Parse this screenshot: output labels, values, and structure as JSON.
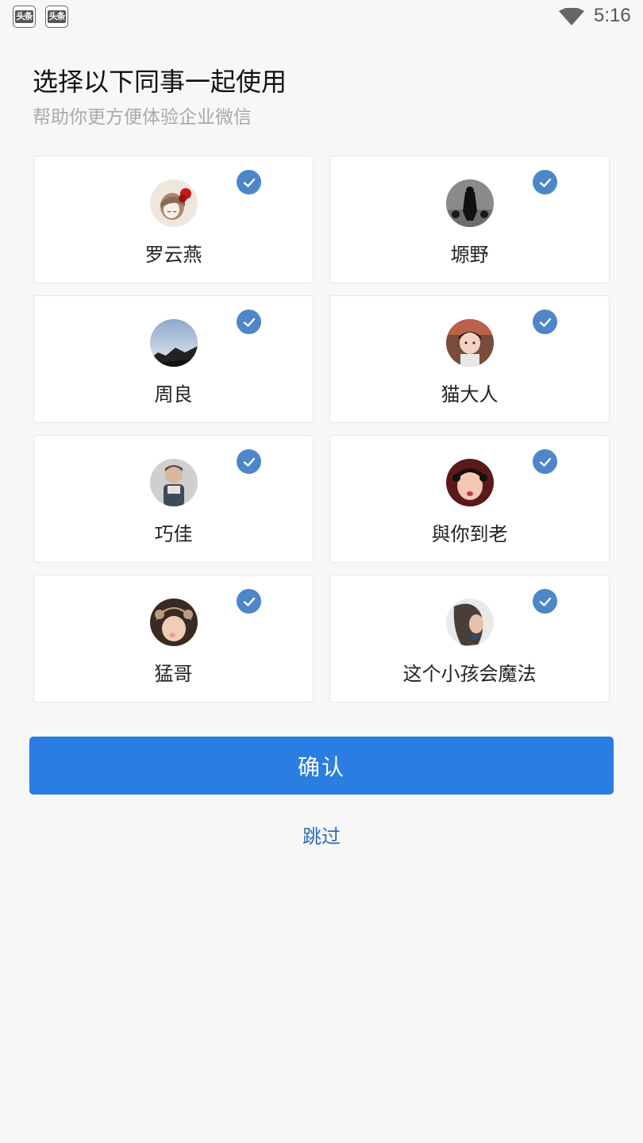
{
  "status_bar": {
    "notifications": [
      {
        "icon": "toutiao-app-icon",
        "label": "头条"
      },
      {
        "icon": "toutiao-app-icon",
        "label": "头条"
      }
    ],
    "wifi_icon": "wifi-icon",
    "time": "5:16"
  },
  "header": {
    "title": "选择以下同事一起使用",
    "subtitle": "帮助你更方便体验企业微信"
  },
  "colleagues": [
    {
      "name": "罗云燕",
      "avatar": "cartoon-girl-avatar",
      "selected": true
    },
    {
      "name": "塬野",
      "avatar": "dark-figure-avatar",
      "selected": true
    },
    {
      "name": "周良",
      "avatar": "mountain-sky-avatar",
      "selected": true
    },
    {
      "name": "猫大人",
      "avatar": "child-photo-avatar",
      "selected": true
    },
    {
      "name": "巧佳",
      "avatar": "child-overalls-avatar",
      "selected": true
    },
    {
      "name": "與你到老",
      "avatar": "child-bow-avatar",
      "selected": true
    },
    {
      "name": "猛哥",
      "avatar": "baby-hat-avatar",
      "selected": true
    },
    {
      "name": "这个小孩会魔法",
      "avatar": "girl-profile-avatar",
      "selected": true
    }
  ],
  "actions": {
    "confirm_label": "确认",
    "skip_label": "跳过"
  },
  "colors": {
    "primary": "#2a7de1",
    "check": "#4d86c9",
    "link": "#2f6db4",
    "subtitle": "#a6a9ae",
    "background": "#f7f7f7"
  }
}
